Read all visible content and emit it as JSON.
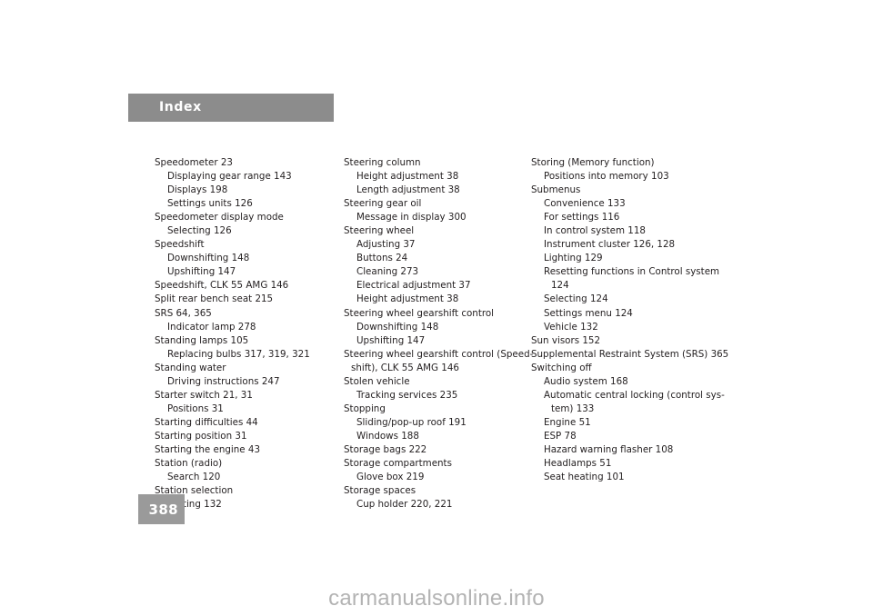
{
  "header": {
    "title": "Index"
  },
  "footer": {
    "page_number": "388",
    "watermark": "carmanualsonline.info"
  },
  "colors": {
    "header_bar": "#8c8c8c",
    "page_tab": "#9a9a9a",
    "text": "#231f20",
    "watermark": "#b3b3b3",
    "background": "#ffffff"
  },
  "index_columns": [
    {
      "id": "column-1",
      "lines": [
        {
          "text": "Speedometer 23",
          "level": 0,
          "wrapped": false
        },
        {
          "text": "Displaying gear range 143",
          "level": 1,
          "wrapped": false
        },
        {
          "text": "Displays 198",
          "level": 1,
          "wrapped": false
        },
        {
          "text": "Settings units 126",
          "level": 1,
          "wrapped": false
        },
        {
          "text": "Speedometer display mode",
          "level": 0,
          "wrapped": false
        },
        {
          "text": "Selecting 126",
          "level": 1,
          "wrapped": false
        },
        {
          "text": "Speedshift",
          "level": 0,
          "wrapped": false
        },
        {
          "text": "Downshifting 148",
          "level": 1,
          "wrapped": false
        },
        {
          "text": "Upshifting 147",
          "level": 1,
          "wrapped": false
        },
        {
          "text": "Speedshift, CLK 55 AMG 146",
          "level": 0,
          "wrapped": false
        },
        {
          "text": "Split rear bench seat 215",
          "level": 0,
          "wrapped": false
        },
        {
          "text": "SRS 64, 365",
          "level": 0,
          "wrapped": false
        },
        {
          "text": "Indicator lamp 278",
          "level": 1,
          "wrapped": false
        },
        {
          "text": "Standing lamps 105",
          "level": 0,
          "wrapped": false
        },
        {
          "text": "Replacing bulbs 317, 319, 321",
          "level": 1,
          "wrapped": false
        },
        {
          "text": "Standing water",
          "level": 0,
          "wrapped": false
        },
        {
          "text": "Driving instructions 247",
          "level": 1,
          "wrapped": false
        },
        {
          "text": "Starter switch 21, 31",
          "level": 0,
          "wrapped": false
        },
        {
          "text": "Positions 31",
          "level": 1,
          "wrapped": false
        },
        {
          "text": "Starting difficulties 44",
          "level": 0,
          "wrapped": false
        },
        {
          "text": "Starting position 31",
          "level": 0,
          "wrapped": false
        },
        {
          "text": "Starting the engine 43",
          "level": 0,
          "wrapped": false
        },
        {
          "text": "Station (radio)",
          "level": 0,
          "wrapped": false
        },
        {
          "text": "Search 120",
          "level": 1,
          "wrapped": false
        },
        {
          "text": "Station selection",
          "level": 0,
          "wrapped": false
        },
        {
          "text": "Setting 132",
          "level": 1,
          "wrapped": false
        }
      ]
    },
    {
      "id": "column-2",
      "lines": [
        {
          "text": "Steering column",
          "level": 0,
          "wrapped": false
        },
        {
          "text": "Height adjustment 38",
          "level": 1,
          "wrapped": false
        },
        {
          "text": "Length adjustment 38",
          "level": 1,
          "wrapped": false
        },
        {
          "text": "Steering gear oil",
          "level": 0,
          "wrapped": false
        },
        {
          "text": "Message in display 300",
          "level": 1,
          "wrapped": false
        },
        {
          "text": "Steering wheel",
          "level": 0,
          "wrapped": false
        },
        {
          "text": "Adjusting 37",
          "level": 1,
          "wrapped": false
        },
        {
          "text": "Buttons 24",
          "level": 1,
          "wrapped": false
        },
        {
          "text": "Cleaning 273",
          "level": 1,
          "wrapped": false
        },
        {
          "text": "Electrical adjustment 37",
          "level": 1,
          "wrapped": false
        },
        {
          "text": "Height adjustment 38",
          "level": 1,
          "wrapped": false
        },
        {
          "text": "Steering wheel gearshift control",
          "level": 0,
          "wrapped": false
        },
        {
          "text": "Downshifting 148",
          "level": 1,
          "wrapped": false
        },
        {
          "text": "Upshifting 147",
          "level": 1,
          "wrapped": false
        },
        {
          "text": "Steering wheel gearshift control (Speed-",
          "level": 0,
          "wrapped": false
        },
        {
          "text": "shift), CLK 55 AMG 146",
          "level": 0,
          "wrapped": true
        },
        {
          "text": "Stolen vehicle",
          "level": 0,
          "wrapped": false
        },
        {
          "text": "Tracking services 235",
          "level": 1,
          "wrapped": false
        },
        {
          "text": "Stopping",
          "level": 0,
          "wrapped": false
        },
        {
          "text": "Sliding/pop-up roof 191",
          "level": 1,
          "wrapped": false
        },
        {
          "text": "Windows 188",
          "level": 1,
          "wrapped": false
        },
        {
          "text": "Storage bags 222",
          "level": 0,
          "wrapped": false
        },
        {
          "text": "Storage compartments",
          "level": 0,
          "wrapped": false
        },
        {
          "text": "Glove box 219",
          "level": 1,
          "wrapped": false
        },
        {
          "text": "Storage spaces",
          "level": 0,
          "wrapped": false
        },
        {
          "text": "Cup holder 220, 221",
          "level": 1,
          "wrapped": false
        }
      ]
    },
    {
      "id": "column-3",
      "lines": [
        {
          "text": "Storing (Memory function)",
          "level": 0,
          "wrapped": false
        },
        {
          "text": "Positions into memory 103",
          "level": 1,
          "wrapped": false
        },
        {
          "text": "Submenus",
          "level": 0,
          "wrapped": false
        },
        {
          "text": "Convenience 133",
          "level": 1,
          "wrapped": false
        },
        {
          "text": "For settings 116",
          "level": 1,
          "wrapped": false
        },
        {
          "text": "In control system 118",
          "level": 1,
          "wrapped": false
        },
        {
          "text": "Instrument cluster 126, 128",
          "level": 1,
          "wrapped": false
        },
        {
          "text": "Lighting 129",
          "level": 1,
          "wrapped": false
        },
        {
          "text": "Resetting functions in Control system",
          "level": 1,
          "wrapped": false
        },
        {
          "text": "124",
          "level": 1,
          "wrapped": true
        },
        {
          "text": "Selecting 124",
          "level": 1,
          "wrapped": false
        },
        {
          "text": "Settings menu 124",
          "level": 1,
          "wrapped": false
        },
        {
          "text": "Vehicle 132",
          "level": 1,
          "wrapped": false
        },
        {
          "text": "Sun visors 152",
          "level": 0,
          "wrapped": false
        },
        {
          "text": "Supplemental Restraint System (SRS) 365",
          "level": 0,
          "wrapped": false
        },
        {
          "text": "Switching off",
          "level": 0,
          "wrapped": false
        },
        {
          "text": "Audio system 168",
          "level": 1,
          "wrapped": false
        },
        {
          "text": "Automatic central locking (control sys-",
          "level": 1,
          "wrapped": false
        },
        {
          "text": "tem) 133",
          "level": 1,
          "wrapped": true
        },
        {
          "text": "Engine 51",
          "level": 1,
          "wrapped": false
        },
        {
          "text": "ESP 78",
          "level": 1,
          "wrapped": false
        },
        {
          "text": "Hazard warning flasher 108",
          "level": 1,
          "wrapped": false
        },
        {
          "text": "Headlamps 51",
          "level": 1,
          "wrapped": false
        },
        {
          "text": "Seat heating 101",
          "level": 1,
          "wrapped": false
        }
      ]
    }
  ]
}
